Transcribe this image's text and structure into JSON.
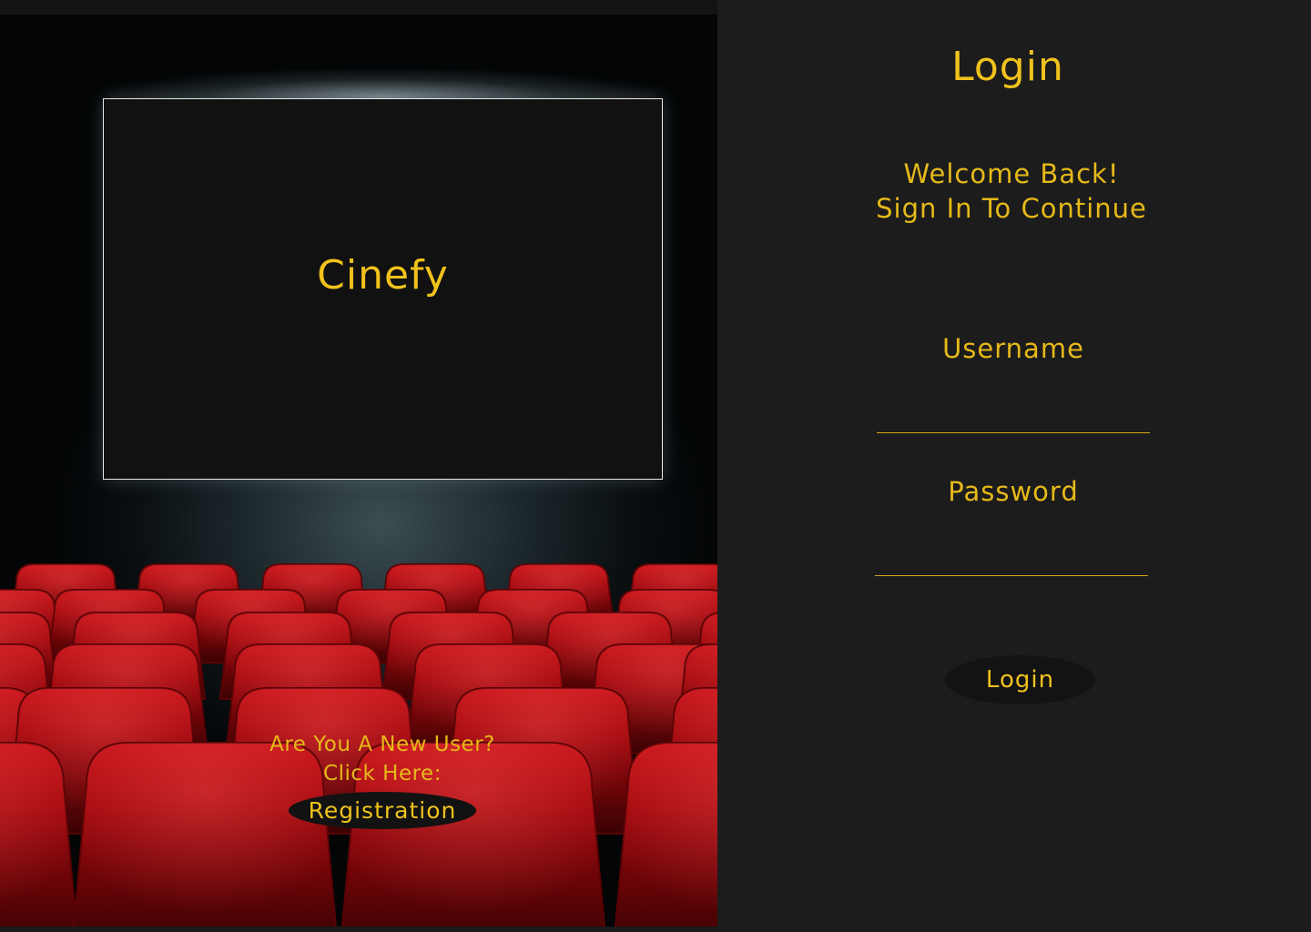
{
  "left": {
    "brand": "Cinefy",
    "register_prompt_line1": "Are You A New User?",
    "register_prompt_line2": "Click Here:",
    "register_button": "Registration"
  },
  "right": {
    "title": "Login",
    "welcome_line1": "Welcome Back!",
    "welcome_line2": "Sign In To Continue",
    "username_label": "Username",
    "username_value": "",
    "password_label": "Password",
    "password_value": "",
    "login_button": "Login"
  },
  "colors": {
    "accent": "#f0c21c",
    "panel_background": "#1c1c1c",
    "screen_background": "#111111",
    "seat_red": "#b3090f"
  },
  "icons": {
    "hero_image": "cinema-seats-illustration"
  }
}
